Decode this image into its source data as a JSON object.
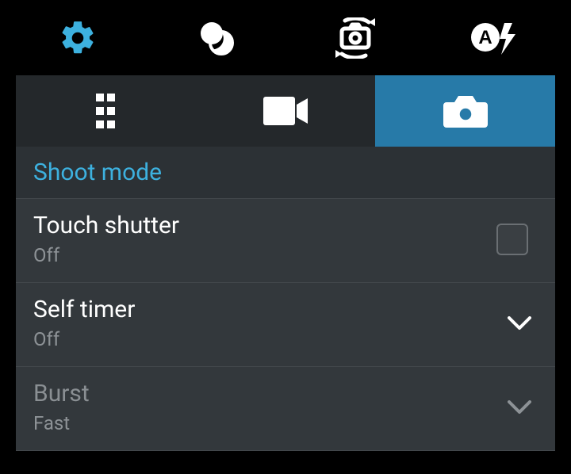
{
  "topbar": {
    "items": [
      {
        "name": "settings-icon",
        "kind": "gear"
      },
      {
        "name": "filters-icon",
        "kind": "overlap-circles"
      },
      {
        "name": "switch-camera-icon",
        "kind": "switch-camera"
      },
      {
        "name": "auto-flash-icon",
        "kind": "auto-flash"
      }
    ]
  },
  "tabs": {
    "items": [
      {
        "name": "tab-misc",
        "kind": "grid-dots",
        "active": false
      },
      {
        "name": "tab-video",
        "kind": "video",
        "active": false
      },
      {
        "name": "tab-photo",
        "kind": "camera",
        "active": true
      }
    ]
  },
  "section": {
    "title": "Shoot mode"
  },
  "rows": [
    {
      "name": "row-touch-shutter",
      "title": "Touch shutter",
      "value": "Off",
      "control": "checkbox",
      "checked": false,
      "disabled": false
    },
    {
      "name": "row-self-timer",
      "title": "Self timer",
      "value": "Off",
      "control": "dropdown",
      "disabled": false
    },
    {
      "name": "row-burst",
      "title": "Burst",
      "value": "Fast",
      "control": "dropdown",
      "disabled": true
    }
  ],
  "colors": {
    "accent": "#3db1df",
    "tabActive": "#277aa8"
  }
}
